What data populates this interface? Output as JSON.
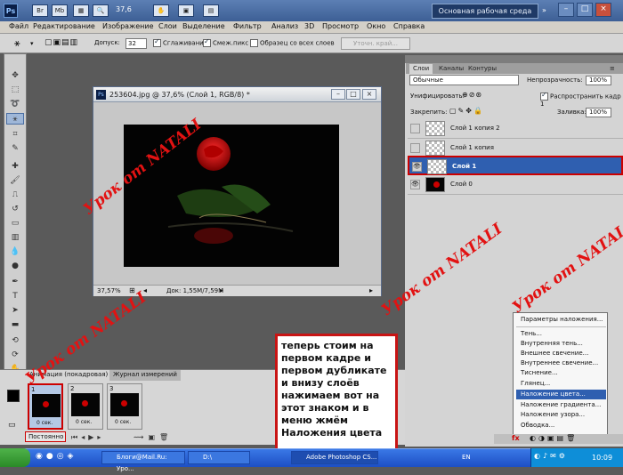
{
  "app": {
    "logo": "Ps",
    "zoom": "37,6",
    "workspace_button": "Основная рабочая среда",
    "window_controls": [
      "–",
      "□",
      "×"
    ]
  },
  "menu": {
    "items": [
      "Файл",
      "Редактирование",
      "Изображение",
      "Слои",
      "Выделение",
      "Фильтр",
      "Анализ",
      "3D",
      "Просмотр",
      "Окно",
      "Справка"
    ]
  },
  "options": {
    "tolerance_label": "Допуск:",
    "tolerance_value": "32",
    "antialias_label": "Сглаживание",
    "contiguous_label": "Смеж.пикс",
    "all_layers_label": "Образец со всех слоев",
    "refine_edge_button": "Уточн. край..."
  },
  "document": {
    "title": "253604.jpg @ 37,6% (Слой 1, RGB/8) *",
    "zoom": "37,57%",
    "doc_size": "Док: 1,55M/7,59M"
  },
  "layers_panel": {
    "tabs": [
      "Слои",
      "Каналы",
      "Контуры"
    ],
    "blend_mode": "Обычные",
    "opacity_label": "Непрозрачность:",
    "opacity_value": "100%",
    "unify_label": "Унифицировать:",
    "propagate_label": "Распространить кадр 1",
    "lock_label": "Закрепить:",
    "fill_label": "Заливка:",
    "fill_value": "100%",
    "layers": [
      {
        "name": "Слой 1 копия 2"
      },
      {
        "name": "Слой 1 копия"
      },
      {
        "name": "Слой 1"
      },
      {
        "name": "Слой 0"
      }
    ]
  },
  "context_menu": {
    "items": [
      "Параметры наложения...",
      "Тень...",
      "Внутренняя тень...",
      "Внешнее свечение...",
      "Внутреннее свечение...",
      "Тиснение...",
      "Глянец...",
      "Наложение цвета...",
      "Наложение градиента...",
      "Наложение узора...",
      "Обводка..."
    ],
    "highlighted": "Наложение цвета..."
  },
  "animation_panel": {
    "tabs": [
      "Анимация (покадровая)",
      "Журнал измерений"
    ],
    "frames": [
      {
        "number": "1",
        "duration": "0 сек."
      },
      {
        "number": "2",
        "duration": "0 сек."
      },
      {
        "number": "3",
        "duration": "0 сек."
      }
    ],
    "loop": "Постоянно"
  },
  "callout": {
    "lines": [
      "теперь стоим на",
      "первом кадре и",
      "первом дубликате",
      "и внизу слоёв",
      "нажимаем вот на",
      "этот знаком и в",
      "меню жмём",
      "Наложения цвета"
    ]
  },
  "watermark": "Урок от NATALI",
  "taskbar": {
    "items": [
      "Блоги@Mail.Ru: Уро...",
      "D:\\",
      "Adobe Photoshop CS..."
    ],
    "lang": "EN",
    "clock": "10:09"
  },
  "colors": {
    "accent_red": "#c81414",
    "selection_blue": "#2f5fb0"
  }
}
